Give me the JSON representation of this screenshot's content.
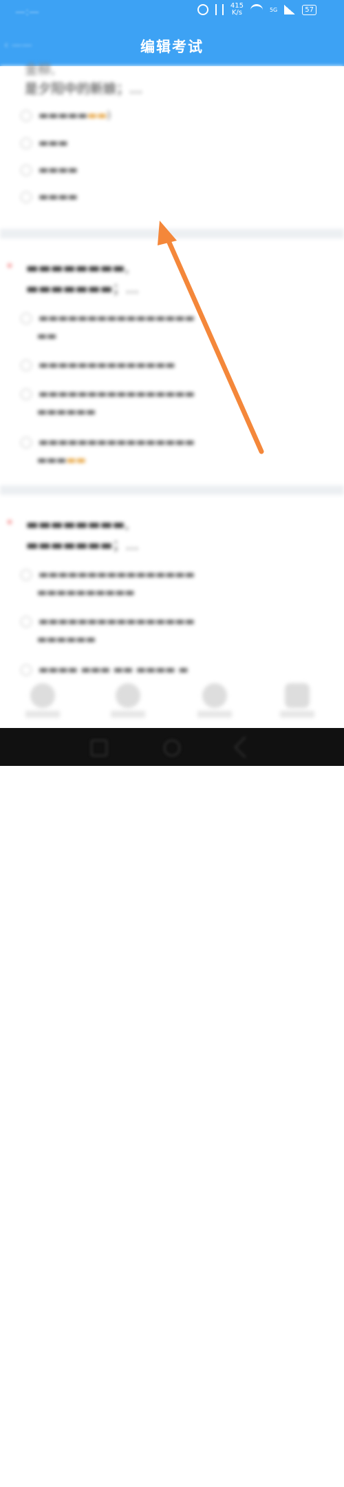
{
  "status": {
    "netspeed_value": "415",
    "netspeed_unit": "K/s",
    "signal_label": "5G",
    "battery": "57"
  },
  "header": {
    "title": "编辑考试"
  },
  "question1": {
    "title_line1": "金柳,",
    "title_line2": "是夕阳中的新娘；…"
  },
  "watermark": {
    "brand": "Bai经验",
    "url": "jingyan.baidu.com"
  },
  "colors": {
    "header_bg": "#3da2f4",
    "annotation_arrow": "#f4873a"
  }
}
